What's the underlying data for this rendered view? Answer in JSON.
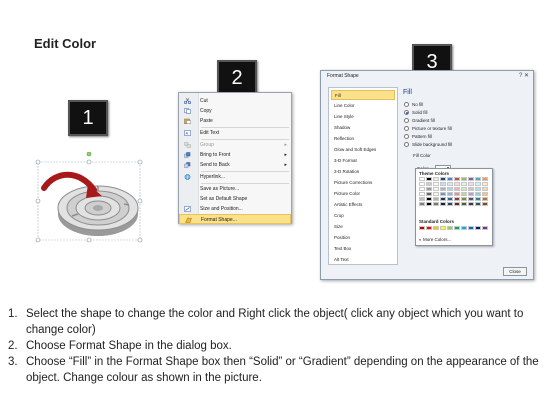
{
  "title": "Edit Color",
  "badges": [
    "1",
    "2",
    "3"
  ],
  "context_menu": {
    "items": [
      {
        "label": "Cut",
        "icon": "scissors-icon",
        "disabled": false,
        "submenu": false
      },
      {
        "label": "Copy",
        "icon": "copy-icon",
        "disabled": false,
        "submenu": false
      },
      {
        "label": "Paste",
        "icon": "paste-icon",
        "disabled": false,
        "submenu": false
      },
      {
        "label": "Edit Text",
        "icon": "edit-text-icon",
        "disabled": false,
        "submenu": false
      },
      {
        "label": "Group",
        "icon": "group-icon",
        "disabled": true,
        "submenu": true
      },
      {
        "label": "Bring to Front",
        "icon": "bring-front-icon",
        "disabled": false,
        "submenu": true
      },
      {
        "label": "Send to Back",
        "icon": "send-back-icon",
        "disabled": false,
        "submenu": true
      },
      {
        "label": "Hyperlink...",
        "icon": "hyperlink-icon",
        "disabled": false,
        "submenu": false
      },
      {
        "label": "Save as Picture...",
        "icon": "",
        "disabled": false,
        "submenu": false
      },
      {
        "label": "Set as Default Shape",
        "icon": "",
        "disabled": false,
        "submenu": false
      },
      {
        "label": "Size and Position...",
        "icon": "size-icon",
        "disabled": false,
        "submenu": false
      },
      {
        "label": "Format Shape...",
        "icon": "format-shape-icon",
        "disabled": false,
        "submenu": false,
        "highlighted": true
      }
    ]
  },
  "dialog": {
    "title": "Format Shape",
    "window_buttons": "? ✕",
    "nav": [
      "Fill",
      "Line Color",
      "Line Style",
      "Shadow",
      "Reflection",
      "Glow and Soft Edges",
      "3-D Format",
      "3-D Rotation",
      "Picture Corrections",
      "Picture Color",
      "Artistic Effects",
      "Crop",
      "Size",
      "Position",
      "Text Box",
      "Alt Text"
    ],
    "selected_nav": "Fill",
    "heading": "Fill",
    "options": [
      "No fill",
      "Solid fill",
      "Gradient fill",
      "Picture or texture fill",
      "Pattern fill",
      "Slide background fill"
    ],
    "selected_option": "Solid fill",
    "fill_color_label": "Fill Color",
    "color_label": "Color:",
    "transparency_label": "Transpa",
    "close_label": "Close"
  },
  "palette": {
    "theme_label": "Theme Colors",
    "standard_label": "Standard Colors",
    "more_label": "More Colors...",
    "theme_top": [
      "#ffffff",
      "#000000",
      "#eeece1",
      "#1f497d",
      "#4f81bd",
      "#c0504d",
      "#9bbb59",
      "#8064a2",
      "#4bacc6",
      "#f79646"
    ],
    "standard": [
      "#c00000",
      "#ff0000",
      "#ffc000",
      "#ffff00",
      "#92d050",
      "#00b050",
      "#00b0f0",
      "#0070c0",
      "#002060",
      "#7030a0"
    ],
    "colors": {
      "accent": "#c00000",
      "highlight": "#fbe28a"
    }
  },
  "instructions": [
    {
      "n": "1.",
      "text": "Select the shape to change the color and Right click the object( click any object which you want to change color)"
    },
    {
      "n": "2.",
      "text": "Choose Format Shape in the dialog box."
    },
    {
      "n": "3.",
      "text": "Choose “Fill” in the Format Shape box then “Solid” or “Gradient” depending on the appearance of the object. Change colour as shown in the picture."
    }
  ]
}
